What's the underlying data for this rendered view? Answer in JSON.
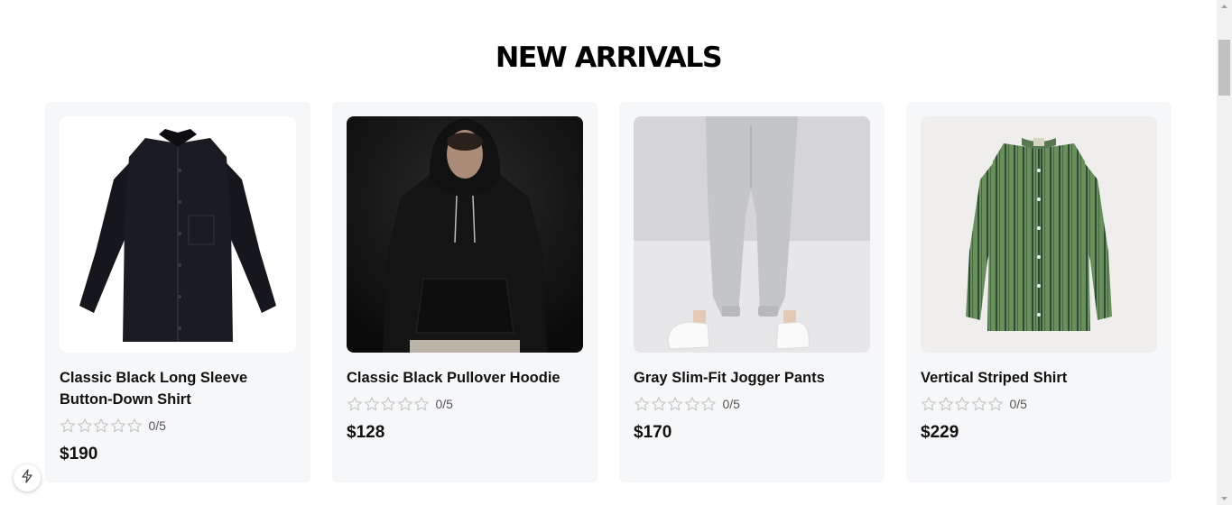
{
  "section": {
    "title": "NEW ARRIVALS"
  },
  "products": [
    {
      "title": "Classic Black Long Sleeve Button-Down Shirt",
      "rating": "0/5",
      "price": "$190"
    },
    {
      "title": "Classic Black Pullover Hoodie",
      "rating": "0/5",
      "price": "$128"
    },
    {
      "title": "Gray Slim-Fit Jogger Pants",
      "rating": "0/5",
      "price": "$170"
    },
    {
      "title": "Vertical Striped Shirt",
      "rating": "0/5",
      "price": "$229"
    }
  ],
  "icons": {
    "star": "star-outline-icon",
    "devtools": "lightning-icon"
  },
  "colors": {
    "card_bg": "#f6f7f9",
    "star": "#c4c4c4",
    "text": "#111111"
  }
}
